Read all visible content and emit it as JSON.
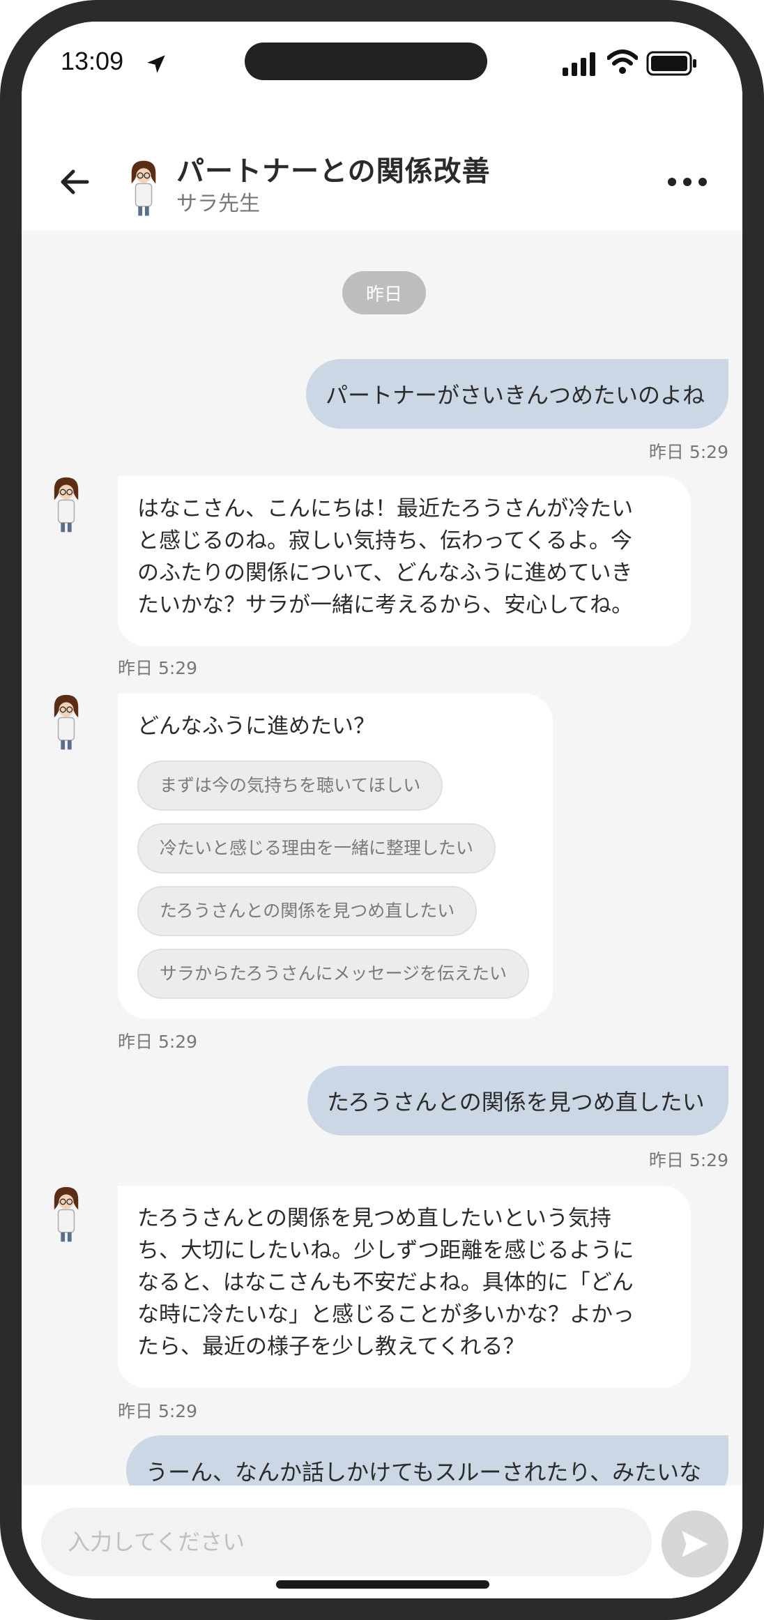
{
  "status_bar": {
    "time": "13:09",
    "icons": [
      "location-arrow-icon",
      "signal-icon",
      "wifi-icon",
      "battery-icon"
    ]
  },
  "header": {
    "title": "パートナーとの関係改善",
    "subtitle": "サラ先生",
    "back_icon": "arrow-left-icon",
    "more_icon": "more-horizontal-icon"
  },
  "chat": {
    "date_separator": "昨日",
    "messages": [
      {
        "from": "user",
        "text": "パートナーがさいきんつめたいのよね",
        "time": "昨日 5:29"
      },
      {
        "from": "bot",
        "lines": [
          "はなこさん、こんにちは！最近たろうさんが冷たい",
          "と感じるのね。寂しい気持ち、伝わってくるよ。今",
          "のふたりの関係について、どんなふうに進めていき",
          "たいかな？サラが一緒に考えるから、安心してね。"
        ],
        "time": "昨日 5:29"
      },
      {
        "from": "bot",
        "text": "どんなふうに進めたい？",
        "options": [
          "まずは今の気持ちを聴いてほしい",
          "冷たいと感じる理由を一緒に整理したい",
          "たろうさんとの関係を見つめ直したい",
          "サラからたろうさんにメッセージを伝えたい"
        ],
        "time": "昨日 5:29"
      },
      {
        "from": "user",
        "text": "たろうさんとの関係を見つめ直したい",
        "time": "昨日 5:29"
      },
      {
        "from": "bot",
        "lines": [
          "たろうさんとの関係を見つめ直したいという気持",
          "ち、大切にしたいね。少しずつ距離を感じるように",
          "なると、はなこさんも不安だよね。具体的に「どん",
          "な時に冷たいな」と感じることが多いかな？よかっ",
          "たら、最近の様子を少し教えてくれる？"
        ],
        "time": "昨日 5:29"
      },
      {
        "from": "user",
        "text": "うーん、なんか話しかけてもスルーされたり、みたいな"
      }
    ]
  },
  "input": {
    "placeholder": "入力してください",
    "send_icon": "send-icon"
  },
  "colors": {
    "user_bubble": "#ccd7e6",
    "bot_bubble": "#ffffff",
    "background": "#f5f5f5"
  }
}
